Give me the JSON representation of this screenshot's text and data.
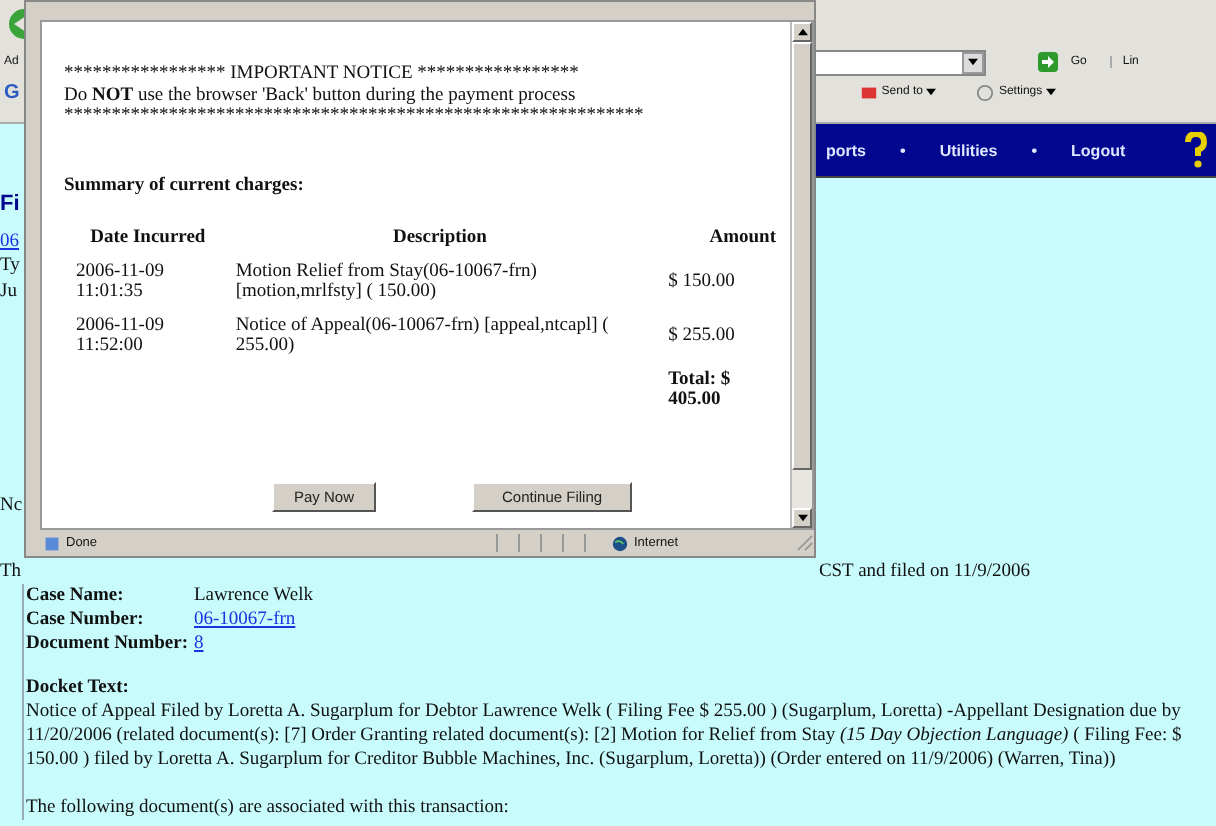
{
  "browser": {
    "address_label": "Ad",
    "go_label": "Go",
    "links_label": "Lin",
    "toolbar_logo": "G",
    "toolbar_buttons": [
      "Send to",
      "Settings"
    ]
  },
  "nav": {
    "items": [
      {
        "kind": "link",
        "label": "ports"
      },
      {
        "kind": "sep",
        "label": "•"
      },
      {
        "kind": "link",
        "label": "Utilities"
      },
      {
        "kind": "sep",
        "label": "•"
      },
      {
        "kind": "link",
        "label": "Logout"
      }
    ]
  },
  "page": {
    "top_fragments": [
      {
        "kind": "heading",
        "text": "Fi"
      },
      {
        "kind": "link",
        "text": "06"
      },
      {
        "kind": "text",
        "text": "Ty"
      },
      {
        "kind": "text",
        "text": "Ju"
      }
    ],
    "lower_fragment": "Nc",
    "filed_head": "Th",
    "filed_tail": "CST and filed on 11/9/2006",
    "fields": [
      {
        "kind": "text",
        "label": "Case Name:",
        "value": "Lawrence Welk"
      },
      {
        "kind": "link",
        "label": "Case Number:",
        "value": "06-10067-frn"
      },
      {
        "kind": "link",
        "label": "Document Number:",
        "value": "8"
      }
    ],
    "docket_heading": "Docket Text:",
    "docket_text": "Notice of Appeal Filed by Loretta A. Sugarplum for Debtor Lawrence Welk ( Filing Fee $ 255.00 ) (Sugarplum, Loretta) -Appellant Designation due by 11/20/2006 (related document(s): [7] Order Granting related document(s): [2] Motion for Relief from Stay *(15 Day Objection Language)* ( Filing Fee: $ 150.00 ) filed by Loretta A. Sugarplum for Creditor Bubble Machines, Inc. (Sugarplum, Loretta)) (Order entered on 11/9/2006) (Warren, Tina))",
    "following": "The following document(s) are associated with this transaction:"
  },
  "popup": {
    "notice_title": "***************** IMPORTANT NOTICE *****************",
    "notice_text": "Do **NOT** use the browser 'Back' button during the payment process",
    "notice_rule": "*************************************************************",
    "summary_heading": "Summary of current charges:",
    "columns": [
      "Date Incurred",
      "Description",
      "Amount"
    ],
    "rows": [
      {
        "date": "2006-11-09 11:01:35",
        "description": "Motion Relief from Stay(06-10067-frn) [motion,mrlfsty] ( 150.00)",
        "amount": "$ 150.00"
      },
      {
        "date": "2006-11-09 11:52:00",
        "description": "Notice of Appeal(06-10067-frn) [appeal,ntcapl] ( 255.00)",
        "amount": "$ 255.00"
      }
    ],
    "total": "Total: $ 405.00",
    "buttons": [
      "Pay Now",
      "Continue Filing"
    ],
    "status": "Done",
    "zone": "Internet"
  }
}
